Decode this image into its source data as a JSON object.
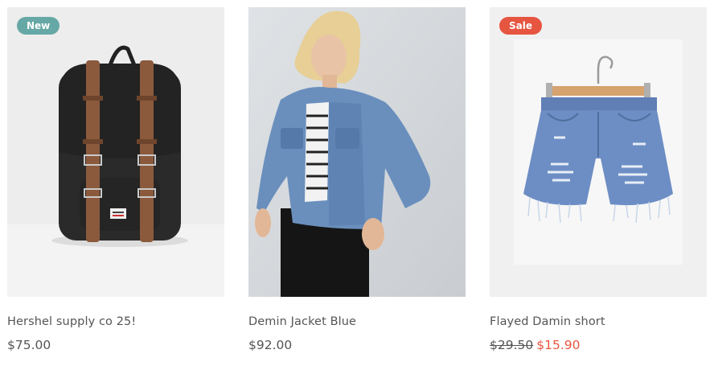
{
  "products": [
    {
      "badge": "New",
      "name": "Hershel supply co 25!",
      "price": "$75.00",
      "image_subject": "black-backpack-with-brown-leather-straps"
    },
    {
      "badge": "",
      "name": "Demin Jacket Blue",
      "price": "$92.00",
      "image_subject": "woman-wearing-denim-jacket"
    },
    {
      "badge": "Sale",
      "name": "Flayed Damin short",
      "old_price": "$29.50",
      "sale_price": "$15.90",
      "image_subject": "distressed-denim-shorts-on-hanger"
    }
  ],
  "colors": {
    "badge_new": "#66a8a6",
    "badge_sale": "#e65540",
    "text": "#555555",
    "sale_price": "#e65540"
  }
}
